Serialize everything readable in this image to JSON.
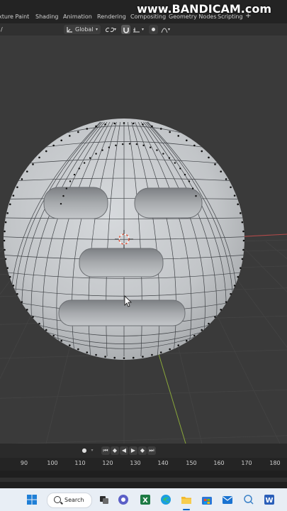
{
  "menubar": {
    "tabs": [
      "xture Paint",
      "Shading",
      "Animation",
      "Rendering",
      "Compositing",
      "Geometry Nodes",
      "Scripting"
    ],
    "add_label": "+"
  },
  "watermark": "www.BANDICAM.com",
  "header": {
    "left_mark": "/",
    "orientation_label": "Global"
  },
  "timeline": {
    "frame_ticks": [
      "90",
      "100",
      "110",
      "120",
      "130",
      "140",
      "150",
      "160",
      "170",
      "180"
    ],
    "controls": [
      "jump-start-icon",
      "prev-keyframe-icon",
      "play-reverse-icon",
      "play-icon",
      "next-keyframe-icon",
      "jump-end-icon"
    ]
  },
  "taskbar": {
    "search_label": "Search"
  },
  "colors": {
    "viewport_bg": "#3a3a3a",
    "mesh_face": "#c9cccf",
    "x_axis": "#b34a4a",
    "y_axis": "#8aa83a"
  }
}
